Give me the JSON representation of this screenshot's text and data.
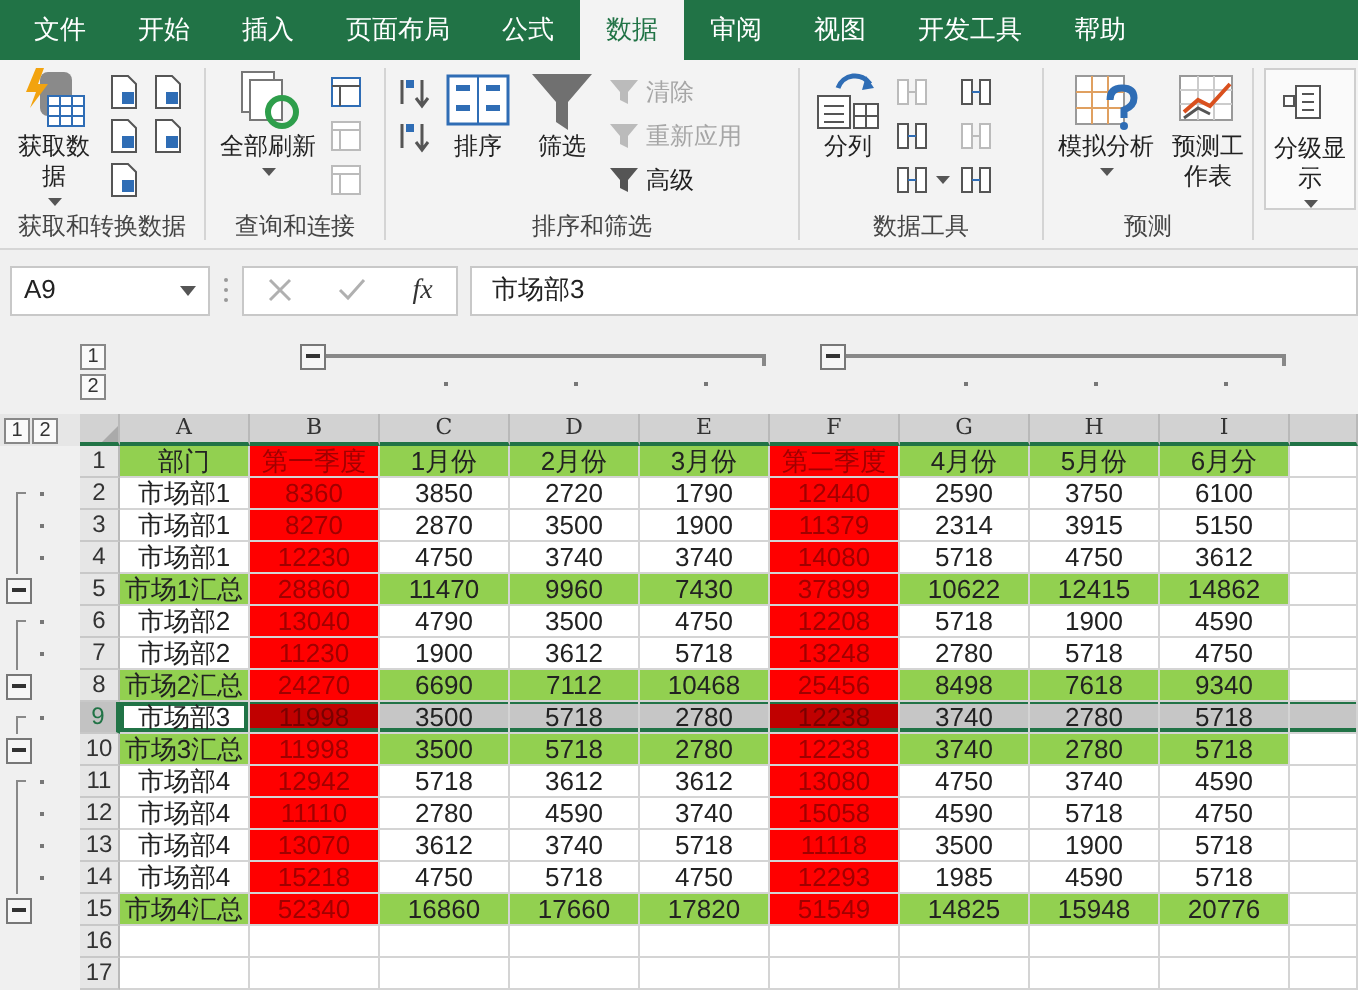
{
  "tabs": [
    {
      "label": "文件",
      "selected": false
    },
    {
      "label": "开始",
      "selected": false
    },
    {
      "label": "插入",
      "selected": false
    },
    {
      "label": "页面布局",
      "selected": false
    },
    {
      "label": "公式",
      "selected": false
    },
    {
      "label": "数据",
      "selected": true
    },
    {
      "label": "审阅",
      "selected": false
    },
    {
      "label": "视图",
      "selected": false
    },
    {
      "label": "开发工具",
      "selected": false
    },
    {
      "label": "帮助",
      "selected": false
    }
  ],
  "ribbon_groups": [
    {
      "title": "获取和转换数据",
      "items": [
        {
          "kind": "large",
          "label": "获取数据",
          "dropdown": true
        },
        {
          "kind": "stack",
          "entries": [
            {
              "disabled": false,
              "dropdown": false
            },
            {
              "disabled": false,
              "dropdown": false
            },
            {
              "disabled": false,
              "dropdown": false
            }
          ]
        },
        {
          "kind": "stack",
          "entries": [
            {
              "disabled": false,
              "dropdown": false
            },
            {
              "disabled": false,
              "dropdown": false
            }
          ]
        }
      ]
    },
    {
      "title": "查询和连接",
      "items": [
        {
          "kind": "large",
          "label": "全部刷新",
          "dropdown": true
        },
        {
          "kind": "stack",
          "entries": [
            {
              "disabled": false,
              "dropdown": false
            },
            {
              "disabled": true,
              "dropdown": false
            },
            {
              "disabled": true,
              "dropdown": false
            }
          ]
        }
      ]
    },
    {
      "title": "排序和筛选",
      "items": [
        {
          "kind": "stack",
          "entries": [
            {
              "disabled": false,
              "dropdown": false
            },
            {
              "disabled": false,
              "dropdown": false
            }
          ]
        },
        {
          "kind": "large",
          "label": "排序",
          "dropdown": false
        },
        {
          "kind": "large",
          "label": "筛选",
          "dropdown": false
        },
        {
          "kind": "stack",
          "entries": [
            {
              "label": "清除",
              "disabled": true,
              "dropdown": false
            },
            {
              "label": "重新应用",
              "disabled": true,
              "dropdown": false
            },
            {
              "label": "高级",
              "disabled": false,
              "dropdown": false
            }
          ]
        }
      ]
    },
    {
      "title": "数据工具",
      "items": [
        {
          "kind": "large",
          "label": "分列",
          "dropdown": false
        },
        {
          "kind": "stack",
          "entries": [
            {
              "disabled": true,
              "dropdown": false
            },
            {
              "disabled": false,
              "dropdown": false
            },
            {
              "disabled": false,
              "dropdown": true
            }
          ]
        },
        {
          "kind": "stack",
          "entries": [
            {
              "disabled": false,
              "dropdown": false
            },
            {
              "disabled": true,
              "dropdown": false
            },
            {
              "disabled": false,
              "dropdown": false
            }
          ]
        }
      ]
    },
    {
      "title": "预测",
      "items": [
        {
          "kind": "large",
          "label": "模拟分析",
          "dropdown": true
        },
        {
          "kind": "large",
          "label": "预测工作表",
          "dropdown": false
        }
      ]
    },
    {
      "items": [
        {
          "kind": "large",
          "label": "分级显示",
          "dropdown": true
        }
      ]
    }
  ],
  "name_box": "A9",
  "fx": "fx",
  "formula": "市场部3",
  "outline_levels": {
    "rows": [
      "1",
      "2"
    ],
    "columns": [
      "1",
      "2"
    ]
  },
  "columns": [
    {
      "letter": "A",
      "kind": "label"
    },
    {
      "letter": "B",
      "kind": "quarter"
    },
    {
      "letter": "C",
      "kind": "month"
    },
    {
      "letter": "D",
      "kind": "month"
    },
    {
      "letter": "E",
      "kind": "month"
    },
    {
      "letter": "F",
      "kind": "quarter"
    },
    {
      "letter": "G",
      "kind": "month"
    },
    {
      "letter": "H",
      "kind": "month"
    },
    {
      "letter": "I",
      "kind": "month"
    }
  ],
  "rows": [
    {
      "num": "1",
      "kind": "header",
      "selected": false,
      "cells": [
        "部门",
        "第一季度",
        "1月份",
        "2月份",
        "3月份",
        "第二季度",
        "4月份",
        "5月份",
        "6月分"
      ]
    },
    {
      "num": "2",
      "kind": "detail",
      "selected": false,
      "cells": [
        "市场部1",
        "8360",
        "3850",
        "2720",
        "1790",
        "12440",
        "2590",
        "3750",
        "6100"
      ]
    },
    {
      "num": "3",
      "kind": "detail",
      "selected": false,
      "cells": [
        "市场部1",
        "8270",
        "2870",
        "3500",
        "1900",
        "11379",
        "2314",
        "3915",
        "5150"
      ]
    },
    {
      "num": "4",
      "kind": "detail",
      "selected": false,
      "cells": [
        "市场部1",
        "12230",
        "4750",
        "3740",
        "3740",
        "14080",
        "5718",
        "4750",
        "3612"
      ]
    },
    {
      "num": "5",
      "kind": "summary",
      "selected": false,
      "cells": [
        "市场1汇总",
        "28860",
        "11470",
        "9960",
        "7430",
        "37899",
        "10622",
        "12415",
        "14862"
      ]
    },
    {
      "num": "6",
      "kind": "detail",
      "selected": false,
      "cells": [
        "市场部2",
        "13040",
        "4790",
        "3500",
        "4750",
        "12208",
        "5718",
        "1900",
        "4590"
      ]
    },
    {
      "num": "7",
      "kind": "detail",
      "selected": false,
      "cells": [
        "市场部2",
        "11230",
        "1900",
        "3612",
        "5718",
        "13248",
        "2780",
        "5718",
        "4750"
      ]
    },
    {
      "num": "8",
      "kind": "summary",
      "selected": false,
      "cells": [
        "市场2汇总",
        "24270",
        "6690",
        "7112",
        "10468",
        "25456",
        "8498",
        "7618",
        "9340"
      ]
    },
    {
      "num": "9",
      "kind": "detail",
      "selected": true,
      "cells": [
        "市场部3",
        "11998",
        "3500",
        "5718",
        "2780",
        "12238",
        "3740",
        "2780",
        "5718"
      ]
    },
    {
      "num": "10",
      "kind": "summary",
      "selected": false,
      "cells": [
        "市场3汇总",
        "11998",
        "3500",
        "5718",
        "2780",
        "12238",
        "3740",
        "2780",
        "5718"
      ]
    },
    {
      "num": "11",
      "kind": "detail",
      "selected": false,
      "cells": [
        "市场部4",
        "12942",
        "5718",
        "3612",
        "3612",
        "13080",
        "4750",
        "3740",
        "4590"
      ]
    },
    {
      "num": "12",
      "kind": "detail",
      "selected": false,
      "cells": [
        "市场部4",
        "11110",
        "2780",
        "4590",
        "3740",
        "15058",
        "4590",
        "5718",
        "4750"
      ]
    },
    {
      "num": "13",
      "kind": "detail",
      "selected": false,
      "cells": [
        "市场部4",
        "13070",
        "3612",
        "3740",
        "5718",
        "11118",
        "3500",
        "1900",
        "5718"
      ]
    },
    {
      "num": "14",
      "kind": "detail",
      "selected": false,
      "cells": [
        "市场部4",
        "15218",
        "4750",
        "5718",
        "4750",
        "12293",
        "1985",
        "4590",
        "5718"
      ]
    },
    {
      "num": "15",
      "kind": "summary",
      "selected": false,
      "cells": [
        "市场4汇总",
        "52340",
        "16860",
        "17660",
        "17820",
        "51549",
        "14825",
        "15948",
        "20776"
      ]
    },
    {
      "num": "16",
      "kind": "empty",
      "selected": false
    },
    {
      "num": "17",
      "kind": "empty",
      "selected": false
    }
  ]
}
